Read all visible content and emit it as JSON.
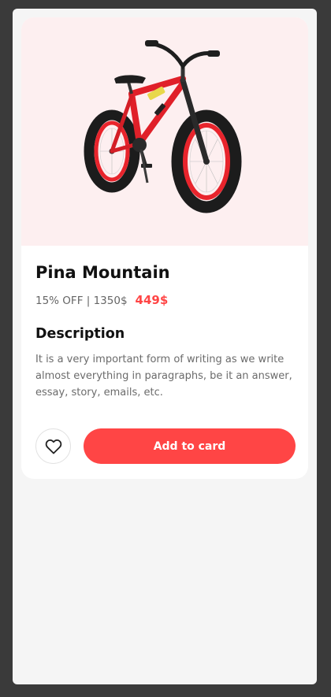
{
  "product": {
    "name": "Pina Mountain",
    "discount_text": "15% OFF | 1350$",
    "price": "449$",
    "image_icon": "bicycle-image"
  },
  "description": {
    "heading": "Description",
    "text": "It is a very important form of writing as we write almost everything in paragraphs, be it an answer, essay, story, emails, etc."
  },
  "actions": {
    "favorite_icon": "heart-icon",
    "add_label": "Add to card"
  },
  "colors": {
    "accent": "#ff4545",
    "hero_bg": "#fdeff0",
    "page_bg": "#f5f5f5",
    "frame_bg": "#3a3a3a"
  }
}
